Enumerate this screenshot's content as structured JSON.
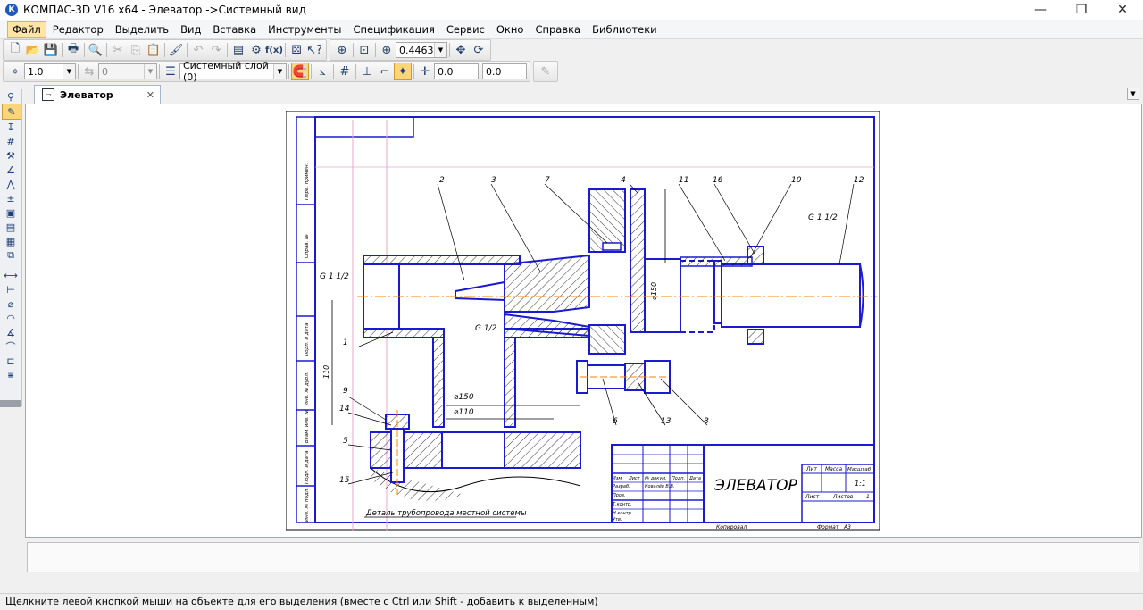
{
  "window": {
    "title": "КОМПАС-3D V16  x64 - Элеватор ->Системный вид",
    "logo_letter": "K",
    "min": "—",
    "max": "❐",
    "close": "✕"
  },
  "menu": [
    "Файл",
    "Редактор",
    "Выделить",
    "Вид",
    "Вставка",
    "Инструменты",
    "Спецификация",
    "Сервис",
    "Окно",
    "Справка",
    "Библиотеки"
  ],
  "toolbar": {
    "zoom_value": "0.4463",
    "style_value": "1.0",
    "layer_value": "0",
    "system_layer": "Системный слой (0)",
    "coord_x": "0.0",
    "coord_y": "0.0",
    "fx_label": "f(x)"
  },
  "document_tab": {
    "label": "Элеватор",
    "close": "✕"
  },
  "drawing": {
    "title": "ЭЛЕВАТОР",
    "section_note": "Деталь трубопровода местной системы",
    "thread_left": "G 1 1/2",
    "thread_mid": "G 1/2",
    "thread_right": "G 1 1/2",
    "dim_150_top": "⌀150",
    "dim_150": "⌀150",
    "dim_110": "⌀110",
    "dim_110_vert": "110",
    "balloons": [
      "2",
      "3",
      "7",
      "4",
      "11",
      "16",
      "10",
      "12",
      "1",
      "9",
      "14",
      "5",
      "15",
      "6",
      "13",
      "8"
    ],
    "sheet_info": {
      "lit_header": "Лит",
      "mass_header": "Масса",
      "scale_header": "Масштаб",
      "scale": "1:1",
      "sheet": "Лист",
      "sheets": "Листов",
      "sheets_count": "1",
      "copied": "Копировал",
      "format": "Формат",
      "format_value": "А3",
      "rows": [
        "Изм.",
        "Лист",
        "№ докум.",
        "Подп.",
        "Дата",
        "Разраб.",
        "Ковалёв В.В.",
        "Пров.",
        "Т.контр.",
        "Н.контр.",
        "Утв."
      ]
    },
    "side_labels": [
      "Перв. примен.",
      "Справ. №",
      "Подп. и дата",
      "Инв. № дубл.",
      "Взам. инв. №",
      "Подп. и дата",
      "Инв. № подл."
    ]
  },
  "status_text": "Щелкните левой кнопкой мыши на объекте для его выделения (вместе с Ctrl или Shift - добавить к выделенным)"
}
